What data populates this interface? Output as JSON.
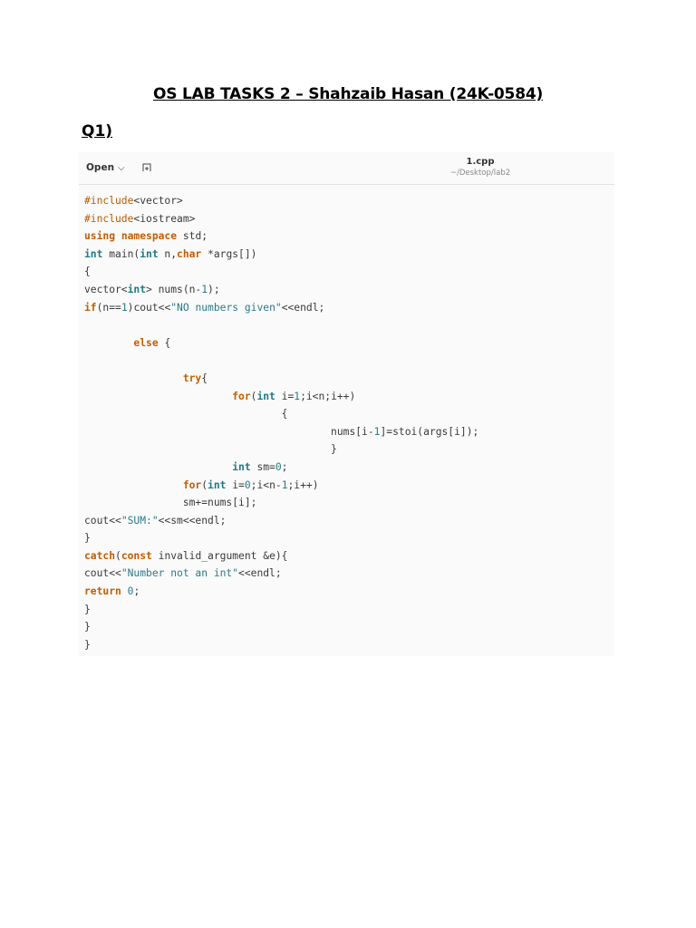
{
  "document": {
    "title": "OS LAB TASKS 2 – Shahzaib Hasan (24K-0584)",
    "question": "Q1)"
  },
  "editor": {
    "open_label": "Open",
    "open_chevron": "⌵",
    "new_tab_icon": "new-tab-icon",
    "file_name": "1.cpp",
    "file_path": "~/Desktop/lab2",
    "colors": {
      "keyword": "#c35d00",
      "type": "#1f7a84",
      "preprocessor": "#b85a00",
      "string": "#2a7a8a",
      "text": "#3a3a3a",
      "background": "#fafafa"
    },
    "code_lines": [
      "#include<vector>",
      "#include<iostream>",
      "using namespace std;",
      "int main(int n,char *args[])",
      "{",
      "vector<int> nums(n-1);",
      "if(n==1)cout<<\"NO numbers given\"<<endl;",
      "",
      "        else {",
      "",
      "                try{",
      "                        for(int i=1;i<n;i++)",
      "                                {",
      "                                        nums[i-1]=stoi(args[i]);",
      "                                        }",
      "                        int sm=0;",
      "                for(int i=0;i<n-1;i++)",
      "                sm+=nums[i];",
      "cout<<\"SUM:\"<<sm<<endl;",
      "}",
      "catch(const invalid_argument &e){",
      "cout<<\"Number not an int\"<<endl;",
      "return 0;",
      "}",
      "}",
      "}"
    ]
  }
}
